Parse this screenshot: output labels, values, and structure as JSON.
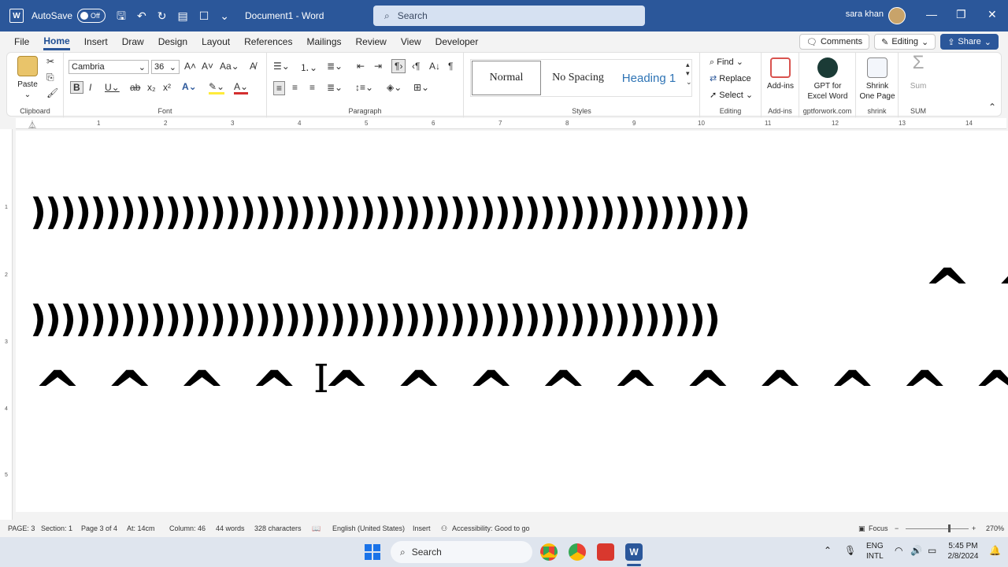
{
  "titlebar": {
    "autosave_label": "AutoSave",
    "autosave_state": "Off",
    "doc_title": "Document1  -  Word",
    "search_placeholder": "Search",
    "user_name": "sara khan"
  },
  "menu": {
    "tabs": [
      "File",
      "Home",
      "Insert",
      "Draw",
      "Design",
      "Layout",
      "References",
      "Mailings",
      "Review",
      "View",
      "Developer"
    ],
    "active_tab": "Home",
    "comments_label": "Comments",
    "editing_label": "Editing",
    "share_label": "Share"
  },
  "ribbon": {
    "clipboard": {
      "paste": "Paste",
      "label": "Clipboard"
    },
    "font": {
      "name": "Cambria",
      "size": "36",
      "label": "Font"
    },
    "paragraph": {
      "label": "Paragraph"
    },
    "styles": {
      "items": [
        "Normal",
        "No Spacing",
        "Heading 1"
      ],
      "label": "Styles"
    },
    "editing": {
      "find": "Find",
      "replace": "Replace",
      "select": "Select",
      "label": "Editing"
    },
    "addins": {
      "button": "Add-ins",
      "label": "Add-ins"
    },
    "gpt": {
      "line1": "GPT for",
      "line2": "Excel Word",
      "label": "gptforwork.com"
    },
    "shrink": {
      "line1": "Shrink",
      "line2": "One Page",
      "label": "shrink"
    },
    "sum": {
      "button": "Sum",
      "label": "SUM"
    }
  },
  "ruler": [
    "1",
    "2",
    "3",
    "4",
    "5",
    "6",
    "7",
    "8",
    "9",
    "10",
    "11",
    "12",
    "13",
    "14"
  ],
  "vruler": [
    "1",
    "2",
    "3",
    "4",
    "5"
  ],
  "document": {
    "line1": "))))))))))))))))))))))))))))))))))))))))))))))))",
    "line_top_right": "^ ^",
    "line2": "))))))))))))))))))))))))))))))))))))))))))))))",
    "line3": "^ ^ ^ ^ ^ ^ ^ ^ ^ ^ ^ ^ ^ ^ ^ ^ ^ ^ ^"
  },
  "status": {
    "page": "PAGE: 3",
    "section": "Section: 1",
    "page_of": "Page 3 of 4",
    "at": "At: 14cm",
    "column": "Column: 46",
    "words": "44 words",
    "chars": "328 characters",
    "language": "English (United States)",
    "mode": "Insert",
    "accessibility": "Accessibility: Good to go",
    "focus": "Focus",
    "zoom": "270%"
  },
  "taskbar": {
    "search": "Search",
    "lang1": "ENG",
    "lang2": "INTL",
    "time": "5:45 PM",
    "date": "2/8/2024"
  }
}
